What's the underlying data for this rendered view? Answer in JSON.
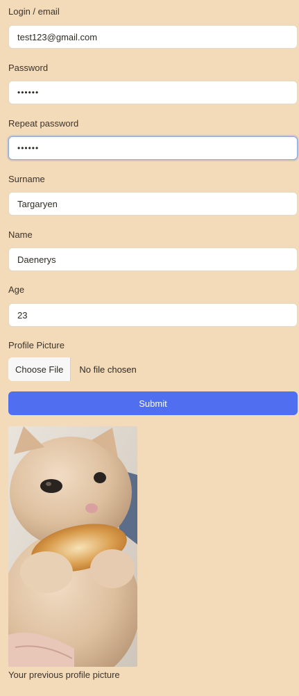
{
  "form": {
    "login": {
      "label": "Login / email",
      "value": "test123@gmail.com"
    },
    "password": {
      "label": "Password",
      "value": "••••••"
    },
    "repeat_password": {
      "label": "Repeat password",
      "value": "••••••"
    },
    "surname": {
      "label": "Surname",
      "value": "Targaryen"
    },
    "name": {
      "label": "Name",
      "value": "Daenerys"
    },
    "age": {
      "label": "Age",
      "value": "23"
    },
    "profile_picture": {
      "label": "Profile Picture",
      "button_label": "Choose File",
      "status": "No file chosen"
    },
    "submit_label": "Submit",
    "previous_picture_caption": "Your previous profile picture"
  },
  "colors": {
    "background": "#f3dab9",
    "submit": "#4f6ef0",
    "field": "#ffffff"
  }
}
